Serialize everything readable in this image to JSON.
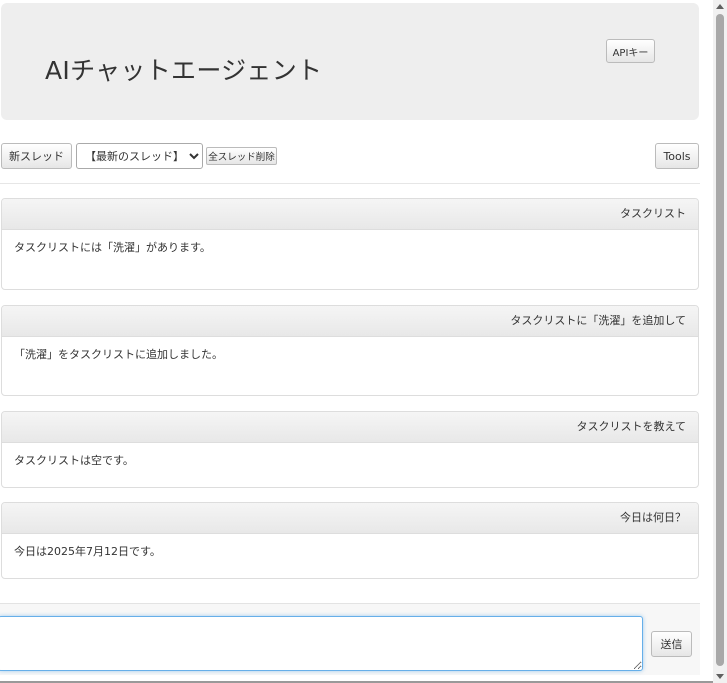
{
  "header": {
    "title": "AIチャットエージェント",
    "api_key_label": "APIキー"
  },
  "toolbar": {
    "new_thread_label": "新スレッド",
    "thread_select_value": "【最新のスレッド】",
    "delete_all_label": "全スレッド削除",
    "tools_label": "Tools"
  },
  "messages": [
    {
      "question": "タスクリスト",
      "answer": "タスクリストには「洗濯」があります。"
    },
    {
      "question": "タスクリストに「洗濯」を追加して",
      "answer": "「洗濯」をタスクリストに追加しました。"
    },
    {
      "question": "タスクリストを教えて",
      "answer": "タスクリストは空です。"
    },
    {
      "question": "今日は何日？",
      "answer": "今日は2025年7月12日です。"
    }
  ],
  "input": {
    "value": "",
    "send_label": "送信"
  }
}
